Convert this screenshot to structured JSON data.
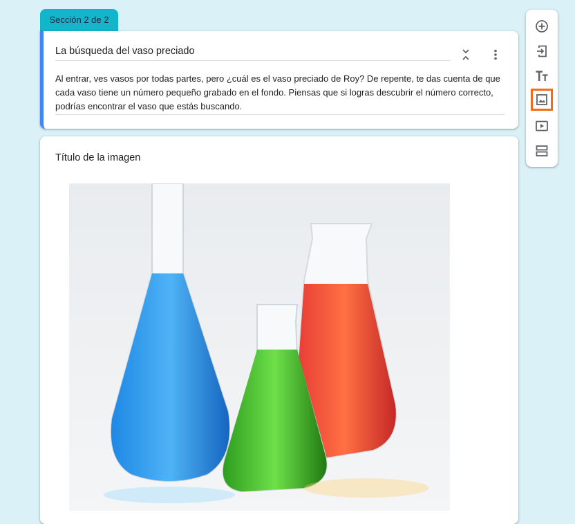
{
  "section_tab": {
    "label": "Sección 2 de 2"
  },
  "section_header": {
    "title": "La búsqueda del vaso preciado",
    "description": "Al entrar, ves vasos por todas partes, pero ¿cuál es el vaso preciado de Roy? De repente, te das cuenta de que cada vaso tiene un número pequeño grabado en el fondo. Piensas que si logras descubrir el número correcto, podrías encontrar el vaso que estás buscando.",
    "icons": [
      "collapse-icon",
      "more-vert-icon"
    ],
    "accent_color": "#4285f4"
  },
  "image_item": {
    "title": "Título de la imagen",
    "image_subject": "three laboratory flasks with blue, green and orange-red liquid"
  },
  "toolbar": {
    "items": [
      {
        "icon": "add-question-icon"
      },
      {
        "icon": "import-questions-icon"
      },
      {
        "icon": "add-title-icon"
      },
      {
        "icon": "add-image-icon",
        "highlighted": true
      },
      {
        "icon": "add-video-icon"
      },
      {
        "icon": "add-section-icon"
      }
    ],
    "highlight_color": "#f26b1d"
  },
  "colors": {
    "background": "#d9f1f7",
    "section_tab": "#12b5cb"
  }
}
